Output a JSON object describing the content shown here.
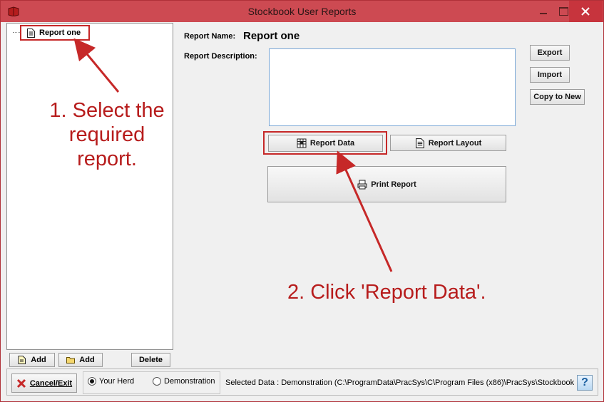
{
  "window": {
    "title": "Stockbook User Reports",
    "accent_color": "#cd4a52",
    "close_color": "#c7343d"
  },
  "tree": {
    "items": [
      {
        "label": "Report one",
        "icon": "document-icon"
      }
    ]
  },
  "details": {
    "report_name_label": "Report Name:",
    "report_name_value": "Report one",
    "report_description_label": "Report Description:",
    "report_description_value": ""
  },
  "buttons": {
    "export": "Export",
    "import": "Import",
    "copy_to_new": "Copy to New",
    "report_data": "Report Data",
    "report_layout": "Report Layout",
    "print_report": "Print Report"
  },
  "left_bottom": {
    "add_report": "Add",
    "add_folder": "Add",
    "delete": "Delete"
  },
  "status": {
    "cancel_exit_first": "C",
    "cancel_exit_rest": "ancel/Exit",
    "radio_your_herd": "Your Herd",
    "radio_demonstration": "Demonstration",
    "selected_radio": "Your Herd",
    "selected_data": "Selected Data : Demonstration (C:\\ProgramData\\PracSys\\C\\Program Files (x86)\\PracSys\\Stockbook CU"
  },
  "annotations": {
    "step1_line1": "1. Select the",
    "step1_line2": "required",
    "step1_line3": "report.",
    "step2": "2. Click 'Report Data'.",
    "color": "#b71c1c"
  }
}
